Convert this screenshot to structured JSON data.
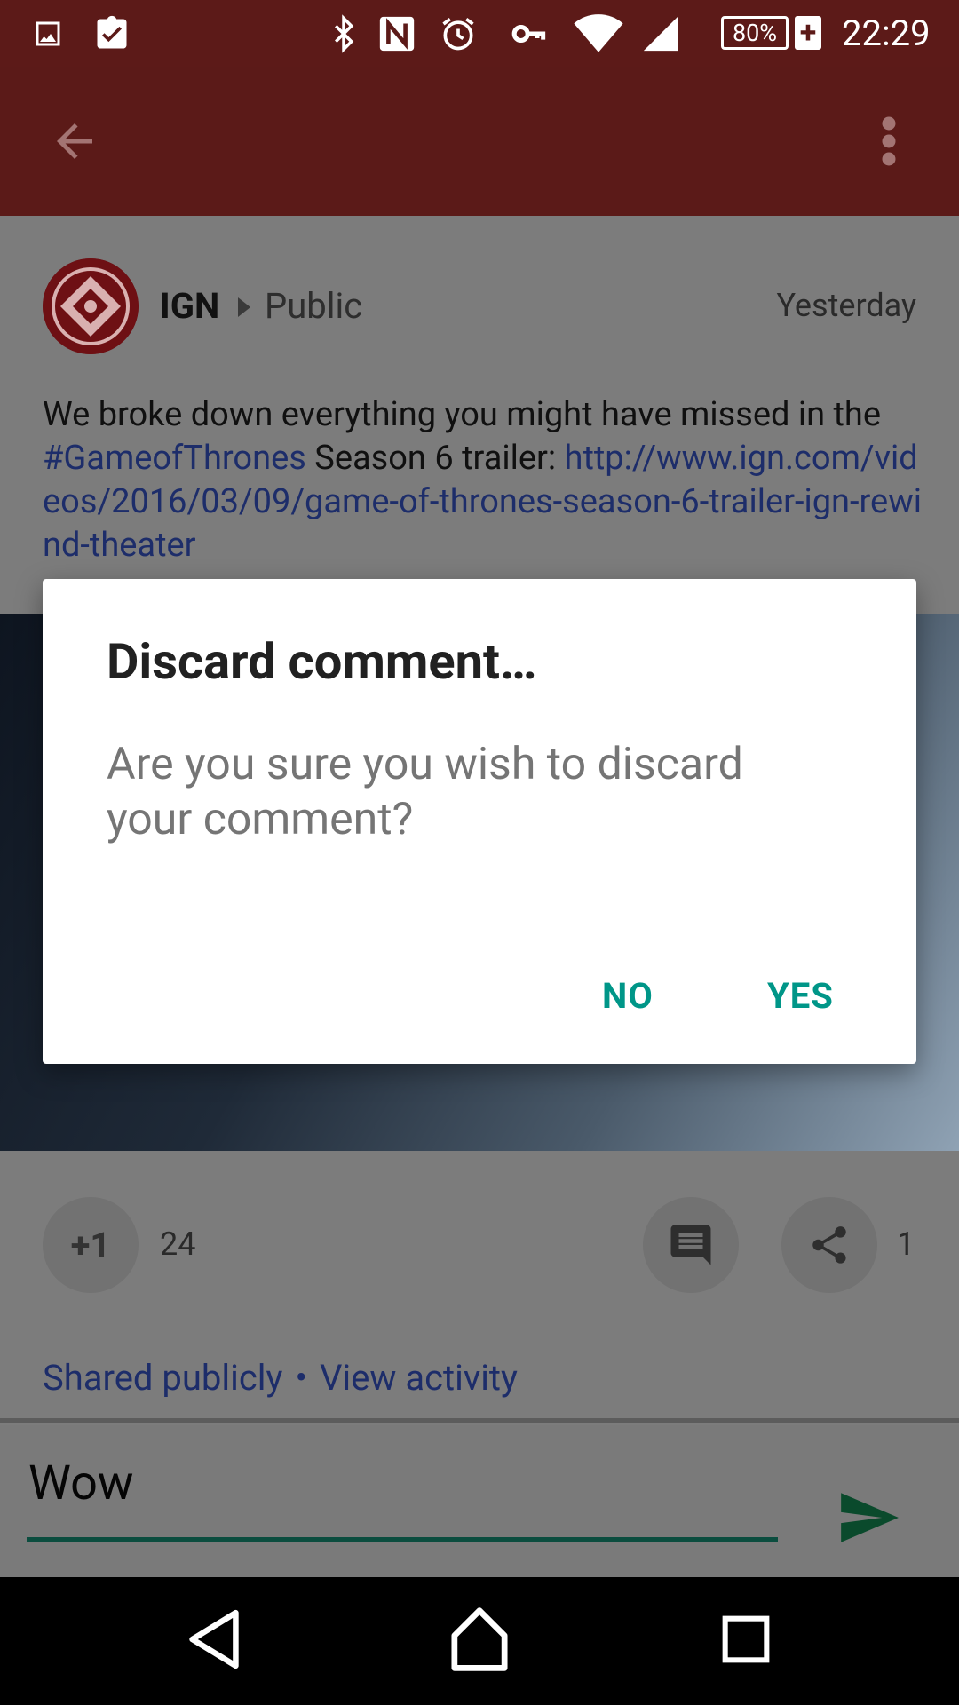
{
  "status_bar": {
    "icons": [
      "image-icon",
      "clipboard-check-icon",
      "bluetooth-icon",
      "nfc-icon",
      "alarm-icon",
      "vpn-key-icon",
      "wifi-icon",
      "signal-icon"
    ],
    "battery": "80%",
    "time": "22:29"
  },
  "toolbar": {
    "icons": [
      "back-arrow-icon",
      "more-vert-icon"
    ]
  },
  "post": {
    "author": "IGN",
    "visibility": "Public",
    "timestamp": "Yesterday",
    "text_before": "We broke down everything you might have missed in the ",
    "hashtag": "#GameofThrones",
    "text_middle": " Season 6 trailer: ",
    "link": "http://www.ign.com/videos/2016/03/09/game-of-thrones-season-6-trailer-ign-rewind-theater",
    "plus_one_label": "+1",
    "plus_one_count": "24",
    "share_count": "1",
    "shared_publicly": "Shared publicly",
    "separator": "•",
    "view_activity": "View activity"
  },
  "comment": {
    "value": "Wow"
  },
  "dialog": {
    "title": "Discard comment…",
    "message": "Are you sure you wish to discard your comment?",
    "no_label": "NO",
    "yes_label": "YES",
    "accent_color": "#009688"
  },
  "colors": {
    "status_bar": "#5c1a18",
    "toolbar": "#5b1a18",
    "scrim_bg": "#7c7c7c"
  }
}
